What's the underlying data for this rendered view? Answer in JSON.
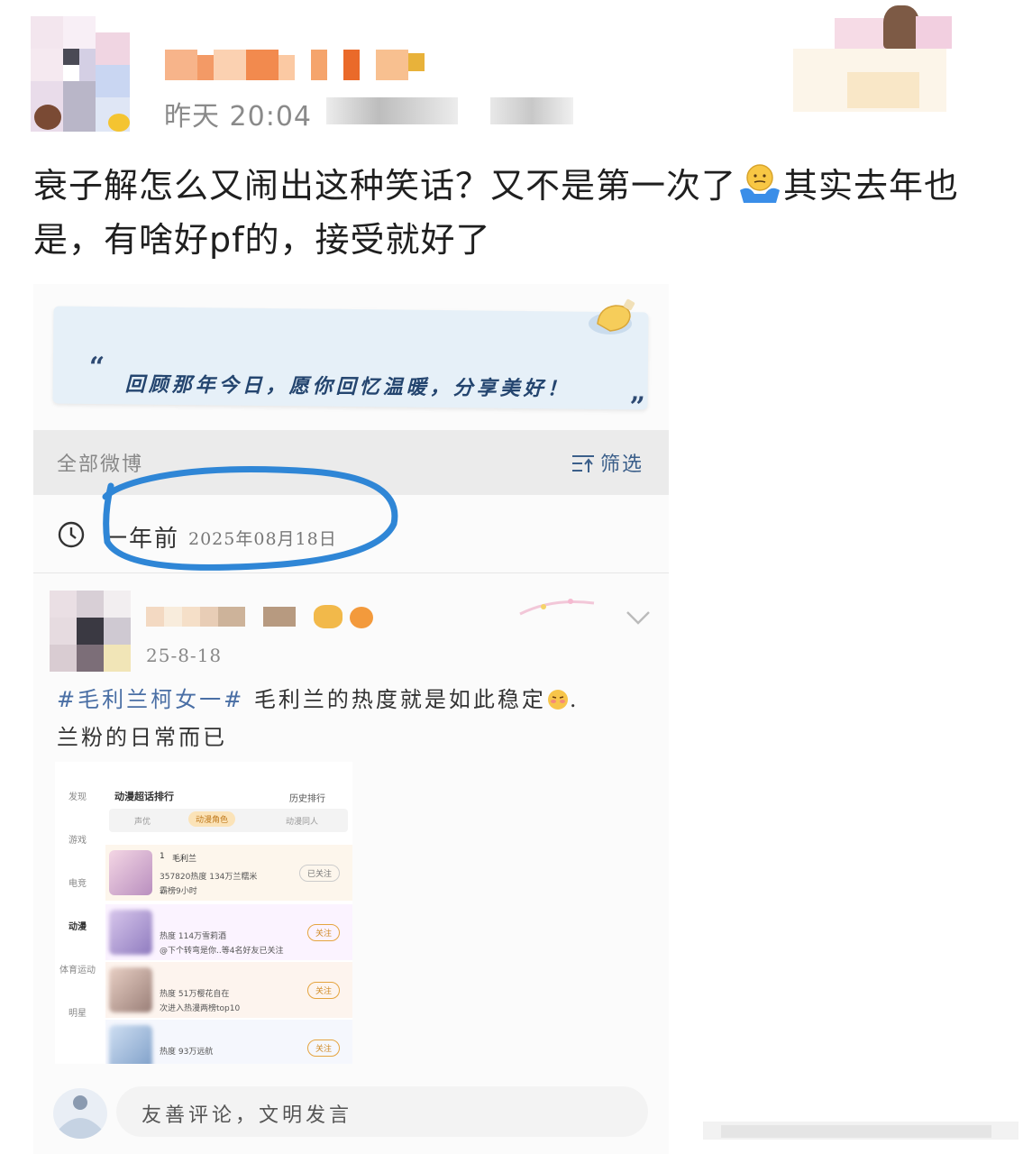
{
  "post": {
    "time": "昨天 20:04",
    "text_part1": "衰子解怎么又闹出这种笑话？又不是第一次了",
    "text_part2": "其实去年也是，有啥好pf的，接受就好了",
    "emoji_icon": "shrug-emoji-icon"
  },
  "memory_card": {
    "quote_open": "“",
    "quote_close": "”",
    "text": "回顾那年今日，愿你回忆温暖，分享美好！"
  },
  "filter_bar": {
    "left_label": "全部微博",
    "right_label": "筛选"
  },
  "time_row": {
    "ago": "一年前",
    "date": "2025年08月18日"
  },
  "inner_post": {
    "date": "25-8-18",
    "tag": "#毛利兰柯女一#",
    "text": " 毛利兰的热度就是如此稳定",
    "text_end": ".",
    "line2": "兰粉的日常而已"
  },
  "ranking": {
    "title": "动漫超话排行",
    "history": "历史排行",
    "tabs": [
      "声优",
      "动漫角色",
      "动漫同人"
    ],
    "side": [
      "发现",
      "游戏",
      "电竞",
      "动漫",
      "体育运动",
      "明星"
    ],
    "rows": [
      {
        "rank": "1",
        "name": "毛利兰",
        "stat": "357820热度 134万兰糯米",
        "sub": "霸榜9小时",
        "button": "已关注"
      },
      {
        "rank": "",
        "name": "",
        "stat": "热度 114万雪莉酒",
        "sub": "@下个转弯是你..等4名好友已关注",
        "button": "关注"
      },
      {
        "rank": "",
        "name": "",
        "stat": "热度 51万樱花自在",
        "sub": "次进入热漫两榜top10",
        "button": "关注"
      },
      {
        "rank": "",
        "name": "",
        "stat": "热度 93万远航",
        "sub": "",
        "button": "关注"
      }
    ]
  },
  "comment": {
    "placeholder": "友善评论，文明发言"
  }
}
